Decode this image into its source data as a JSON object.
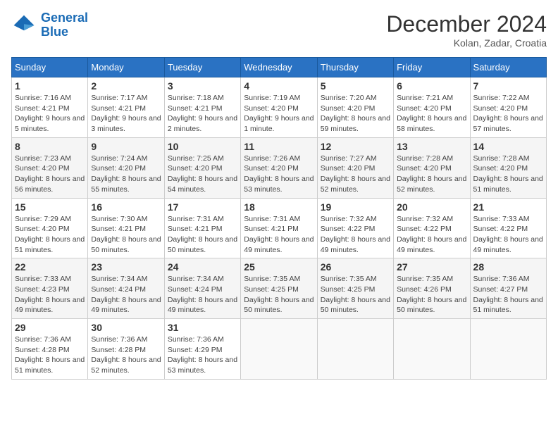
{
  "logo": {
    "text_general": "General",
    "text_blue": "Blue"
  },
  "header": {
    "month_title": "December 2024",
    "location": "Kolan, Zadar, Croatia"
  },
  "days_of_week": [
    "Sunday",
    "Monday",
    "Tuesday",
    "Wednesday",
    "Thursday",
    "Friday",
    "Saturday"
  ],
  "weeks": [
    [
      {
        "day": "1",
        "sunrise": "7:16 AM",
        "sunset": "4:21 PM",
        "daylight": "9 hours and 5 minutes."
      },
      {
        "day": "2",
        "sunrise": "7:17 AM",
        "sunset": "4:21 PM",
        "daylight": "9 hours and 3 minutes."
      },
      {
        "day": "3",
        "sunrise": "7:18 AM",
        "sunset": "4:21 PM",
        "daylight": "9 hours and 2 minutes."
      },
      {
        "day": "4",
        "sunrise": "7:19 AM",
        "sunset": "4:20 PM",
        "daylight": "9 hours and 1 minute."
      },
      {
        "day": "5",
        "sunrise": "7:20 AM",
        "sunset": "4:20 PM",
        "daylight": "8 hours and 59 minutes."
      },
      {
        "day": "6",
        "sunrise": "7:21 AM",
        "sunset": "4:20 PM",
        "daylight": "8 hours and 58 minutes."
      },
      {
        "day": "7",
        "sunrise": "7:22 AM",
        "sunset": "4:20 PM",
        "daylight": "8 hours and 57 minutes."
      }
    ],
    [
      {
        "day": "8",
        "sunrise": "7:23 AM",
        "sunset": "4:20 PM",
        "daylight": "8 hours and 56 minutes."
      },
      {
        "day": "9",
        "sunrise": "7:24 AM",
        "sunset": "4:20 PM",
        "daylight": "8 hours and 55 minutes."
      },
      {
        "day": "10",
        "sunrise": "7:25 AM",
        "sunset": "4:20 PM",
        "daylight": "8 hours and 54 minutes."
      },
      {
        "day": "11",
        "sunrise": "7:26 AM",
        "sunset": "4:20 PM",
        "daylight": "8 hours and 53 minutes."
      },
      {
        "day": "12",
        "sunrise": "7:27 AM",
        "sunset": "4:20 PM",
        "daylight": "8 hours and 52 minutes."
      },
      {
        "day": "13",
        "sunrise": "7:28 AM",
        "sunset": "4:20 PM",
        "daylight": "8 hours and 52 minutes."
      },
      {
        "day": "14",
        "sunrise": "7:28 AM",
        "sunset": "4:20 PM",
        "daylight": "8 hours and 51 minutes."
      }
    ],
    [
      {
        "day": "15",
        "sunrise": "7:29 AM",
        "sunset": "4:20 PM",
        "daylight": "8 hours and 51 minutes."
      },
      {
        "day": "16",
        "sunrise": "7:30 AM",
        "sunset": "4:21 PM",
        "daylight": "8 hours and 50 minutes."
      },
      {
        "day": "17",
        "sunrise": "7:31 AM",
        "sunset": "4:21 PM",
        "daylight": "8 hours and 50 minutes."
      },
      {
        "day": "18",
        "sunrise": "7:31 AM",
        "sunset": "4:21 PM",
        "daylight": "8 hours and 49 minutes."
      },
      {
        "day": "19",
        "sunrise": "7:32 AM",
        "sunset": "4:22 PM",
        "daylight": "8 hours and 49 minutes."
      },
      {
        "day": "20",
        "sunrise": "7:32 AM",
        "sunset": "4:22 PM",
        "daylight": "8 hours and 49 minutes."
      },
      {
        "day": "21",
        "sunrise": "7:33 AM",
        "sunset": "4:22 PM",
        "daylight": "8 hours and 49 minutes."
      }
    ],
    [
      {
        "day": "22",
        "sunrise": "7:33 AM",
        "sunset": "4:23 PM",
        "daylight": "8 hours and 49 minutes."
      },
      {
        "day": "23",
        "sunrise": "7:34 AM",
        "sunset": "4:24 PM",
        "daylight": "8 hours and 49 minutes."
      },
      {
        "day": "24",
        "sunrise": "7:34 AM",
        "sunset": "4:24 PM",
        "daylight": "8 hours and 49 minutes."
      },
      {
        "day": "25",
        "sunrise": "7:35 AM",
        "sunset": "4:25 PM",
        "daylight": "8 hours and 50 minutes."
      },
      {
        "day": "26",
        "sunrise": "7:35 AM",
        "sunset": "4:25 PM",
        "daylight": "8 hours and 50 minutes."
      },
      {
        "day": "27",
        "sunrise": "7:35 AM",
        "sunset": "4:26 PM",
        "daylight": "8 hours and 50 minutes."
      },
      {
        "day": "28",
        "sunrise": "7:36 AM",
        "sunset": "4:27 PM",
        "daylight": "8 hours and 51 minutes."
      }
    ],
    [
      {
        "day": "29",
        "sunrise": "7:36 AM",
        "sunset": "4:28 PM",
        "daylight": "8 hours and 51 minutes."
      },
      {
        "day": "30",
        "sunrise": "7:36 AM",
        "sunset": "4:28 PM",
        "daylight": "8 hours and 52 minutes."
      },
      {
        "day": "31",
        "sunrise": "7:36 AM",
        "sunset": "4:29 PM",
        "daylight": "8 hours and 53 minutes."
      },
      null,
      null,
      null,
      null
    ]
  ]
}
